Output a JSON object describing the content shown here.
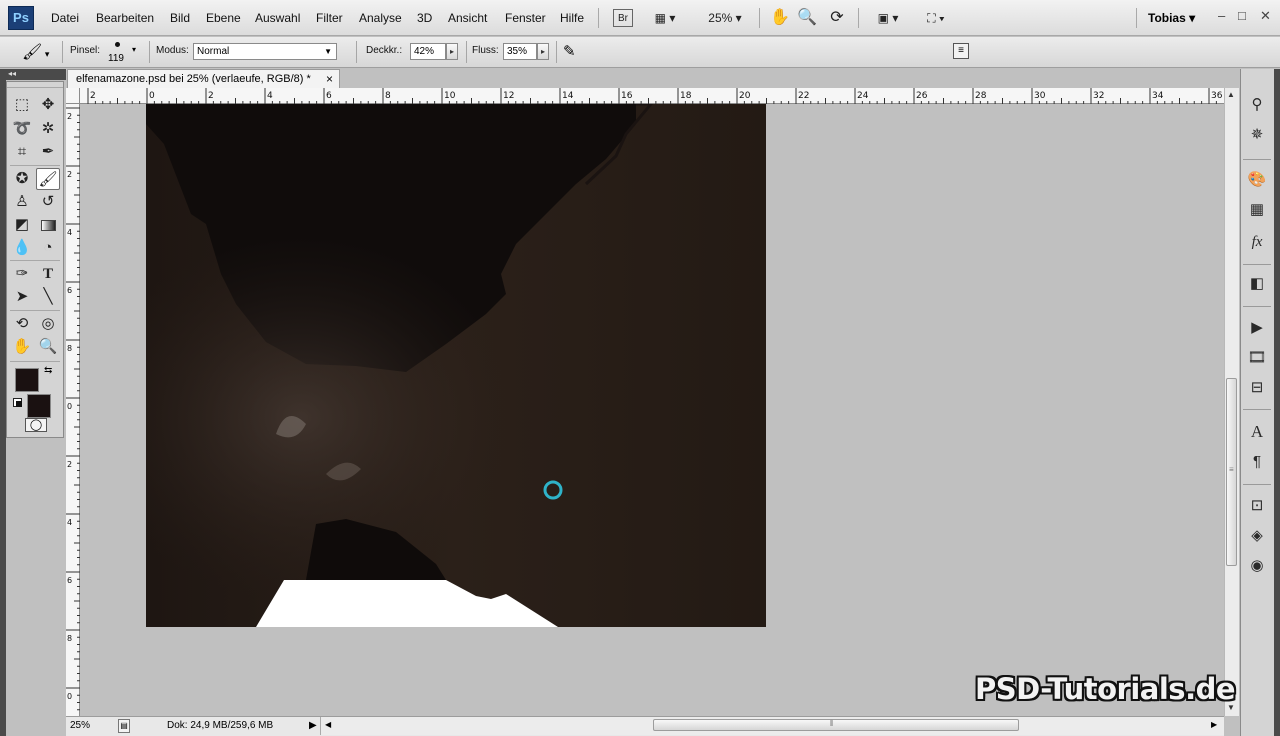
{
  "app": {
    "logo": "Ps",
    "user": "Tobias"
  },
  "menu": [
    "Datei",
    "Bearbeiten",
    "Bild",
    "Ebene",
    "Auswahl",
    "Filter",
    "Analyse",
    "3D",
    "Ansicht",
    "Fenster",
    "Hilfe"
  ],
  "appbar": {
    "bridge_label": "Br",
    "zoom": "25%"
  },
  "options": {
    "brush_label": "Pinsel:",
    "brush_size": "119",
    "mode_label": "Modus:",
    "mode_value": "Normal",
    "opacity_label": "Deckkr.:",
    "opacity_value": "42%",
    "flow_label": "Fluss:",
    "flow_value": "35%"
  },
  "document": {
    "tab_title": "elfenamazone.psd bei 25% (verlaeufe, RGB/8) *",
    "close_glyph": "×"
  },
  "ruler_top": [
    "2",
    "0",
    "2",
    "4",
    "6",
    "8",
    "10",
    "12",
    "14",
    "16",
    "18",
    "20",
    "22",
    "24",
    "26",
    "28",
    "30",
    "32",
    "34",
    "36"
  ],
  "ruler_left": [
    "2",
    "2",
    "4",
    "6",
    "8",
    "0",
    "2",
    "4",
    "6",
    "8",
    "0",
    "2"
  ],
  "status": {
    "zoom": "25%",
    "doc_info": "Dok: 24,9 MB/259,6 MB"
  },
  "watermark": "PSD-Tutorials.de",
  "colors": {
    "foreground": "#1a1111",
    "background": "#1a1111",
    "canvas_base": "#271d17",
    "canvas_dark": "#100c0b",
    "cursor_ring": "#2fb3c9"
  },
  "icons": {
    "tools": [
      "marquee-icon",
      "move-icon",
      "lasso-icon",
      "magic-wand-icon",
      "crop-icon",
      "eyedropper-icon",
      "spot-healing-icon",
      "brush-icon",
      "clone-stamp-icon",
      "history-brush-icon",
      "eraser-icon",
      "gradient-icon",
      "blur-icon",
      "dodge-icon",
      "pen-icon",
      "type-icon",
      "path-selection-icon",
      "line-icon",
      "3d-rotate-icon",
      "3d-orbit-icon",
      "hand-icon",
      "zoom-icon"
    ],
    "dock": [
      "brush-presets-icon",
      "navigator-icon",
      "color-swatches-icon",
      "swatches-icon",
      "styles-icon",
      "adjustments-icon",
      "actions-icon",
      "animation-icon",
      "timeline-icon",
      "character-icon",
      "paragraph-icon",
      "transform-icon",
      "layers-icon",
      "channels-icon"
    ]
  }
}
